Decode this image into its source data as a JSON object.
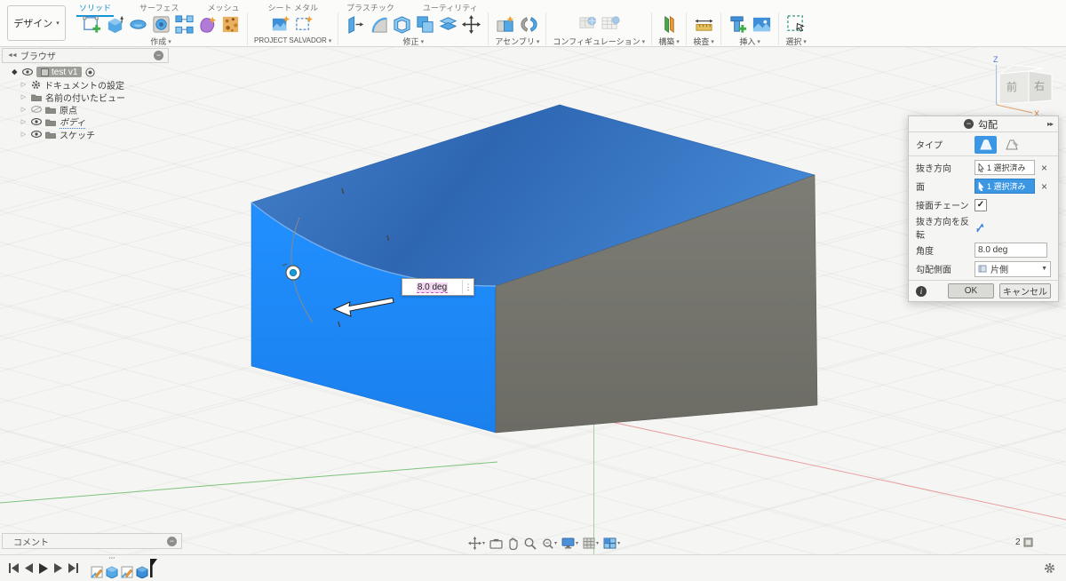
{
  "toolbar": {
    "design_menu": {
      "label": "デザイン"
    },
    "tabs": [
      {
        "label": "ソリッド"
      },
      {
        "label": "サーフェス"
      },
      {
        "label": "メッシュ"
      },
      {
        "label": "シート メタル"
      },
      {
        "label": "プラスチック"
      },
      {
        "label": "ユーティリティ"
      }
    ],
    "groups": {
      "create": "作成",
      "project": "PROJECT SALVADOR",
      "modify": "修正",
      "assemble": "アセンブリ",
      "configure": "コンフィギュレーション",
      "construct": "構築",
      "inspect": "検査",
      "insert": "挿入",
      "select": "選択"
    }
  },
  "browser": {
    "title": "ブラウザ",
    "root_label": "test v1",
    "items": [
      {
        "label": "ドキュメントの設定"
      },
      {
        "label": "名前の付いたビュー"
      },
      {
        "label": "原点"
      },
      {
        "label": "ボディ"
      },
      {
        "label": "スケッチ"
      }
    ]
  },
  "dialog": {
    "title": "勾配",
    "type_label": "タイプ",
    "pull_direction": {
      "label": "抜き方向",
      "value": "1 選択済み"
    },
    "faces": {
      "label": "面",
      "value": "1 選択済み"
    },
    "tangent_chain": {
      "label": "接面チェーン"
    },
    "flip": {
      "label": "抜き方向を反転"
    },
    "angle": {
      "label": "角度",
      "value": "8.0 deg"
    },
    "side": {
      "label": "勾配側面",
      "value": "片側"
    },
    "ok": "OK",
    "cancel": "キャンセル"
  },
  "viewport": {
    "angle_manipulator_value": "8.0 deg",
    "viewcube": {
      "front": "前",
      "right": "右",
      "axis_z": "Z",
      "axis_x": "X"
    }
  },
  "comments": {
    "title": "コメント"
  },
  "statusbar": {
    "selection_count": "2"
  },
  "colors": {
    "front_face_blue": "#1f8cfe",
    "top_face_blue": "#3173c4",
    "side_face_gray": "#73736c",
    "selection_blue": "#3b97e3",
    "active_tab_blue": "#1493d6",
    "axis_green": "#7bc47b",
    "axis_red": "#e8a0a0"
  }
}
